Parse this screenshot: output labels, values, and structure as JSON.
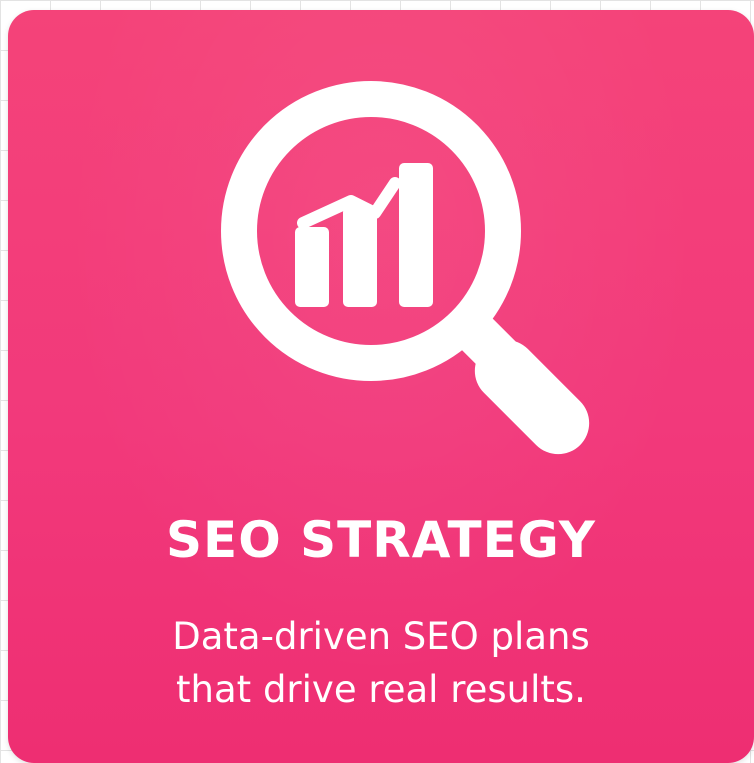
{
  "card": {
    "background_color": "#f2397b",
    "icon": "magnifier-bar-chart-icon",
    "title": "SEO STRATEGY",
    "subtitle_lines": [
      "Data-driven SEO plans",
      "that drive real results."
    ]
  }
}
